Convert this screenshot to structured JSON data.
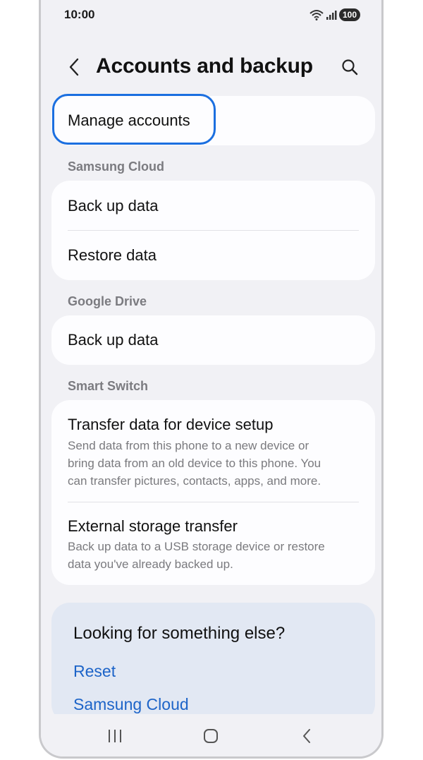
{
  "status": {
    "time": "10:00",
    "battery": "100"
  },
  "header": {
    "title": "Accounts and backup"
  },
  "manage": {
    "label": "Manage accounts"
  },
  "samsung_cloud": {
    "section": "Samsung Cloud",
    "items": [
      "Back up data",
      "Restore data"
    ]
  },
  "google_drive": {
    "section": "Google Drive",
    "items": [
      "Back up data"
    ]
  },
  "smart_switch": {
    "section": "Smart Switch",
    "items": [
      {
        "title": "Transfer data for device setup",
        "lines": [
          "Send data from this phone to a new device or",
          "bring data from an old device to this phone. You",
          "can transfer pictures, contacts, apps, and more."
        ]
      },
      {
        "title": "External storage transfer",
        "lines": [
          "Back up data to a USB storage device or restore",
          "data you've already backed up."
        ]
      }
    ]
  },
  "looking": {
    "title": "Looking for something else?",
    "links": [
      "Reset",
      "Samsung Cloud"
    ]
  },
  "colors": {
    "accent": "#1b6fe0",
    "link": "#1d64c8",
    "background": "#f1f1f5",
    "card": "#fdfdff"
  }
}
